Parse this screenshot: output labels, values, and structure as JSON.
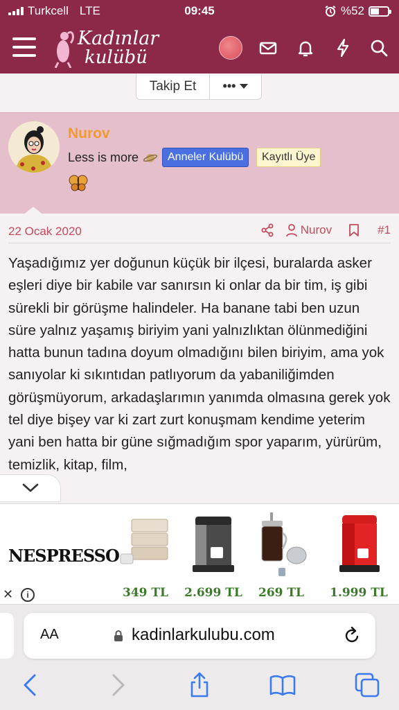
{
  "status": {
    "carrier": "Turkcell",
    "network": "LTE",
    "time": "09:45",
    "battery": "%52",
    "battery_level": 0.52,
    "alarm_icon": "alarm-icon"
  },
  "header": {
    "logo_line1": "Kadınlar",
    "logo_line2": "kulübü",
    "icons": [
      "menu-icon",
      "avatar",
      "mail-icon",
      "bell-icon",
      "bolt-icon",
      "search-icon"
    ],
    "brand_color": "#8c2848"
  },
  "follow": {
    "follow_label": "Takip Et",
    "more_label": "•••"
  },
  "user": {
    "name": "Nurov",
    "title": "Less is more",
    "badges": [
      "Anneler Kulübü",
      "Kayıtlı Üye"
    ],
    "name_color": "#f39a2c"
  },
  "post": {
    "date": "22 Ocak 2020",
    "author": "Nurov",
    "number": "#1",
    "text": "Yaşadığımız yer doğunun küçük bir ilçesi, buralarda asker eşleri diye bir kabile var sanırsın ki onlar da bir tim, iş gibi sürekli bir görüşme halindeler. Ha banane tabi ben uzun süre yalnız yaşamış biriyim yani yalnızlıktan ölünmediğini hatta bunun tadına doyum olmadığını bilen biriyim, ama yok sanıyolar ki sıkıntıdan patlıyorum da yabaniliğimden görüşmüyorum, arkadaşlarımın yanımda olmasına gerek yok tel diye bişey var ki zart zurt konuşmam kendime yeterim yani ben hatta bir güne sığmadığım spor yaparım, yürürüm, temizlik, kitap, film,"
  },
  "ad": {
    "brand": "NESPRESSO",
    "prices": [
      "349 TL",
      "2.699 TL",
      "269 TL",
      "1.999 TL"
    ]
  },
  "browser": {
    "text_size_label": "AA",
    "url": "kadinlarkulubu.com"
  }
}
